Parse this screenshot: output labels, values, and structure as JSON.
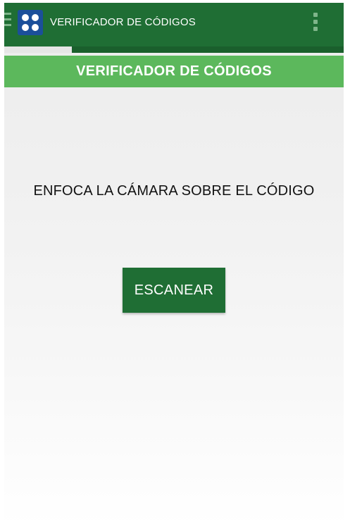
{
  "app_bar": {
    "title": "VERIFICADOR DE CÓDIGOS",
    "logo_icon": "app-logo-icon",
    "menu_icon": "hamburger-menu-icon",
    "overflow_icon": "more-vert-icon",
    "background": "#1f6e34"
  },
  "progress": {
    "fraction": 0.2
  },
  "header": {
    "title": "VERIFICADOR DE CÓDIGOS",
    "background": "#5cb85c"
  },
  "main": {
    "instruction": "ENFOCA LA CÁMARA SOBRE EL CÓDIGO",
    "scan_button_label": "ESCANEAR",
    "scan_button_color": "#1f6e34"
  }
}
